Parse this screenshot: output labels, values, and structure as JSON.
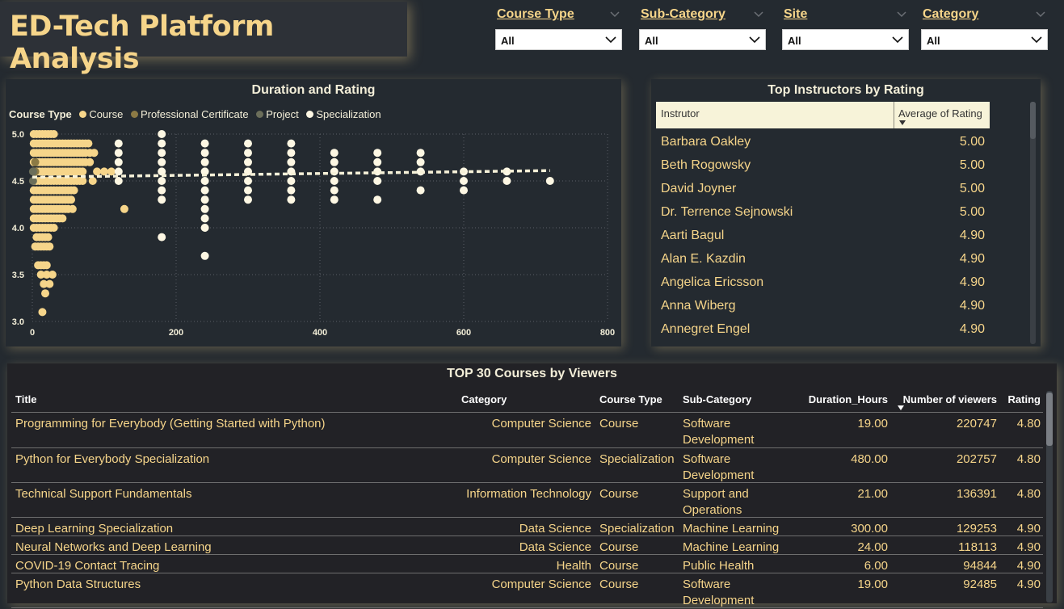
{
  "dashboard": {
    "title": "ED-Tech Platform Analysis"
  },
  "filters": [
    {
      "label": "Course Type",
      "value": "All"
    },
    {
      "label": "Sub-Category",
      "value": "All"
    },
    {
      "label": "Site",
      "value": "All"
    },
    {
      "label": "Category",
      "value": "All"
    }
  ],
  "scatter": {
    "title": "Duration and Rating",
    "legend_title": "Course Type",
    "legend": [
      {
        "name": "Course",
        "color": "#f6d58a"
      },
      {
        "name": "Professional Certificate",
        "color": "#8c7a45"
      },
      {
        "name": "Project",
        "color": "#6b6e5a"
      },
      {
        "name": "Specialization",
        "color": "#fdf7e3"
      }
    ]
  },
  "instructors": {
    "title": "Top Instructors by Rating",
    "col_name": "Instrutor",
    "col_rating": "Average of Rating",
    "rows": [
      {
        "name": "Barbara Oakley",
        "rating": "5.00"
      },
      {
        "name": "Beth Rogowsky",
        "rating": "5.00"
      },
      {
        "name": "David Joyner",
        "rating": "5.00"
      },
      {
        "name": "Dr. Terrence Sejnowski",
        "rating": "5.00"
      },
      {
        "name": "Aarti Bagul",
        "rating": "4.90"
      },
      {
        "name": "Alan E. Kazdin",
        "rating": "4.90"
      },
      {
        "name": "Angelica Ericsson",
        "rating": "4.90"
      },
      {
        "name": "Anna Wiberg",
        "rating": "4.90"
      },
      {
        "name": "Annegret Engel",
        "rating": "4.90"
      }
    ]
  },
  "courses": {
    "title": "TOP 30 Courses by Viewers",
    "columns": [
      "Title",
      "Category",
      "Course Type",
      "Sub-Category",
      "Duration_Hours",
      "Number of viewers",
      "Rating"
    ],
    "rows": [
      {
        "title": "Programming for Everybody (Getting Started with Python)",
        "category": "Computer Science",
        "type": "Course",
        "sub": "Software Development",
        "duration": "19.00",
        "viewers": "220747",
        "rating": "4.80"
      },
      {
        "title": "Python for Everybody Specialization",
        "category": "Computer Science",
        "type": "Specialization",
        "sub": "Software Development",
        "duration": "480.00",
        "viewers": "202757",
        "rating": "4.80"
      },
      {
        "title": "Technical Support Fundamentals",
        "category": "Information Technology",
        "type": "Course",
        "sub": "Support and Operations",
        "duration": "21.00",
        "viewers": "136391",
        "rating": "4.80"
      },
      {
        "title": "Deep Learning Specialization",
        "category": "Data Science",
        "type": "Specialization",
        "sub": "Machine Learning",
        "duration": "300.00",
        "viewers": "129253",
        "rating": "4.90"
      },
      {
        "title": "Neural Networks and Deep Learning",
        "category": "Data Science",
        "type": "Course",
        "sub": "Machine Learning",
        "duration": "24.00",
        "viewers": "118113",
        "rating": "4.90"
      },
      {
        "title": "COVID-19 Contact Tracing",
        "category": "Health",
        "type": "Course",
        "sub": "Public Health",
        "duration": "6.00",
        "viewers": "94844",
        "rating": "4.90"
      },
      {
        "title": "Python Data Structures",
        "category": "Computer Science",
        "type": "Course",
        "sub": "Software Development",
        "duration": "19.00",
        "viewers": "92485",
        "rating": "4.90"
      }
    ]
  },
  "chart_data": {
    "type": "scatter",
    "title": "Duration and Rating",
    "xlabel": "",
    "ylabel": "",
    "xlim": [
      0,
      800
    ],
    "ylim": [
      3.0,
      5.0
    ],
    "x_ticks": [
      "0",
      "200",
      "400",
      "600",
      "800"
    ],
    "y_ticks": [
      "3.0",
      "3.5",
      "4.0",
      "4.5",
      "5.0"
    ],
    "grid": true,
    "legend_placement": "top-left",
    "trend_line": {
      "x": [
        0,
        720
      ],
      "y": [
        4.54,
        4.61
      ]
    },
    "series": [
      {
        "name": "Course",
        "color": "#f6d58a",
        "points": [
          [
            2,
            5.0
          ],
          [
            6,
            5.0
          ],
          [
            10,
            5.0
          ],
          [
            14,
            5.0
          ],
          [
            18,
            5.0
          ],
          [
            22,
            5.0
          ],
          [
            26,
            5.0
          ],
          [
            30,
            5.0
          ],
          [
            2,
            4.9
          ],
          [
            6,
            4.9
          ],
          [
            10,
            4.9
          ],
          [
            14,
            4.9
          ],
          [
            18,
            4.9
          ],
          [
            22,
            4.9
          ],
          [
            26,
            4.9
          ],
          [
            30,
            4.9
          ],
          [
            34,
            4.9
          ],
          [
            38,
            4.9
          ],
          [
            42,
            4.9
          ],
          [
            46,
            4.9
          ],
          [
            50,
            4.9
          ],
          [
            54,
            4.9
          ],
          [
            58,
            4.9
          ],
          [
            62,
            4.9
          ],
          [
            66,
            4.9
          ],
          [
            70,
            4.9
          ],
          [
            74,
            4.9
          ],
          [
            78,
            4.9
          ],
          [
            2,
            4.8
          ],
          [
            6,
            4.8
          ],
          [
            10,
            4.8
          ],
          [
            14,
            4.8
          ],
          [
            18,
            4.8
          ],
          [
            22,
            4.8
          ],
          [
            26,
            4.8
          ],
          [
            30,
            4.8
          ],
          [
            34,
            4.8
          ],
          [
            38,
            4.8
          ],
          [
            42,
            4.8
          ],
          [
            46,
            4.8
          ],
          [
            50,
            4.8
          ],
          [
            54,
            4.8
          ],
          [
            58,
            4.8
          ],
          [
            62,
            4.8
          ],
          [
            66,
            4.8
          ],
          [
            70,
            4.8
          ],
          [
            74,
            4.8
          ],
          [
            80,
            4.8
          ],
          [
            86,
            4.8
          ],
          [
            2,
            4.7
          ],
          [
            6,
            4.7
          ],
          [
            10,
            4.7
          ],
          [
            14,
            4.7
          ],
          [
            18,
            4.7
          ],
          [
            22,
            4.7
          ],
          [
            26,
            4.7
          ],
          [
            30,
            4.7
          ],
          [
            34,
            4.7
          ],
          [
            38,
            4.7
          ],
          [
            42,
            4.7
          ],
          [
            46,
            4.7
          ],
          [
            50,
            4.7
          ],
          [
            54,
            4.7
          ],
          [
            58,
            4.7
          ],
          [
            62,
            4.7
          ],
          [
            66,
            4.7
          ],
          [
            70,
            4.7
          ],
          [
            74,
            4.7
          ],
          [
            80,
            4.7
          ],
          [
            2,
            4.6
          ],
          [
            6,
            4.6
          ],
          [
            10,
            4.6
          ],
          [
            14,
            4.6
          ],
          [
            18,
            4.6
          ],
          [
            22,
            4.6
          ],
          [
            26,
            4.6
          ],
          [
            30,
            4.6
          ],
          [
            34,
            4.6
          ],
          [
            38,
            4.6
          ],
          [
            42,
            4.6
          ],
          [
            46,
            4.6
          ],
          [
            50,
            4.6
          ],
          [
            54,
            4.6
          ],
          [
            58,
            4.6
          ],
          [
            62,
            4.6
          ],
          [
            66,
            4.6
          ],
          [
            70,
            4.6
          ],
          [
            90,
            4.6
          ],
          [
            100,
            4.6
          ],
          [
            110,
            4.6
          ],
          [
            2,
            4.5
          ],
          [
            6,
            4.5
          ],
          [
            10,
            4.5
          ],
          [
            14,
            4.5
          ],
          [
            18,
            4.5
          ],
          [
            22,
            4.5
          ],
          [
            26,
            4.5
          ],
          [
            30,
            4.5
          ],
          [
            34,
            4.5
          ],
          [
            38,
            4.5
          ],
          [
            42,
            4.5
          ],
          [
            46,
            4.5
          ],
          [
            50,
            4.5
          ],
          [
            54,
            4.5
          ],
          [
            58,
            4.5
          ],
          [
            62,
            4.5
          ],
          [
            66,
            4.5
          ],
          [
            70,
            4.5
          ],
          [
            84,
            4.5
          ],
          [
            2,
            4.4
          ],
          [
            6,
            4.4
          ],
          [
            10,
            4.4
          ],
          [
            14,
            4.4
          ],
          [
            18,
            4.4
          ],
          [
            22,
            4.4
          ],
          [
            26,
            4.4
          ],
          [
            30,
            4.4
          ],
          [
            34,
            4.4
          ],
          [
            38,
            4.4
          ],
          [
            42,
            4.4
          ],
          [
            46,
            4.4
          ],
          [
            50,
            4.4
          ],
          [
            54,
            4.4
          ],
          [
            58,
            4.4
          ],
          [
            2,
            4.3
          ],
          [
            6,
            4.3
          ],
          [
            10,
            4.3
          ],
          [
            14,
            4.3
          ],
          [
            18,
            4.3
          ],
          [
            22,
            4.3
          ],
          [
            26,
            4.3
          ],
          [
            30,
            4.3
          ],
          [
            34,
            4.3
          ],
          [
            38,
            4.3
          ],
          [
            42,
            4.3
          ],
          [
            46,
            4.3
          ],
          [
            50,
            4.3
          ],
          [
            54,
            4.3
          ],
          [
            2,
            4.2
          ],
          [
            6,
            4.2
          ],
          [
            10,
            4.2
          ],
          [
            14,
            4.2
          ],
          [
            18,
            4.2
          ],
          [
            22,
            4.2
          ],
          [
            26,
            4.2
          ],
          [
            30,
            4.2
          ],
          [
            34,
            4.2
          ],
          [
            38,
            4.2
          ],
          [
            42,
            4.2
          ],
          [
            46,
            4.2
          ],
          [
            50,
            4.2
          ],
          [
            56,
            4.2
          ],
          [
            2,
            4.1
          ],
          [
            6,
            4.1
          ],
          [
            10,
            4.1
          ],
          [
            14,
            4.1
          ],
          [
            18,
            4.1
          ],
          [
            22,
            4.1
          ],
          [
            26,
            4.1
          ],
          [
            30,
            4.1
          ],
          [
            34,
            4.1
          ],
          [
            38,
            4.1
          ],
          [
            42,
            4.1
          ],
          [
            2,
            4.0
          ],
          [
            6,
            4.0
          ],
          [
            10,
            4.0
          ],
          [
            14,
            4.0
          ],
          [
            18,
            4.0
          ],
          [
            22,
            4.0
          ],
          [
            26,
            4.0
          ],
          [
            30,
            4.0
          ],
          [
            6,
            3.9
          ],
          [
            10,
            3.9
          ],
          [
            14,
            3.9
          ],
          [
            18,
            3.9
          ],
          [
            22,
            3.9
          ],
          [
            4,
            3.8
          ],
          [
            8,
            3.8
          ],
          [
            12,
            3.8
          ],
          [
            16,
            3.8
          ],
          [
            20,
            3.8
          ],
          [
            24,
            3.8
          ],
          [
            8,
            3.6
          ],
          [
            12,
            3.6
          ],
          [
            16,
            3.6
          ],
          [
            20,
            3.6
          ],
          [
            12,
            3.5
          ],
          [
            20,
            3.5
          ],
          [
            28,
            3.5
          ],
          [
            16,
            3.4
          ],
          [
            24,
            3.4
          ],
          [
            18,
            3.3
          ],
          [
            14,
            3.1
          ],
          [
            128,
            4.2
          ]
        ]
      },
      {
        "name": "Professional Certificate",
        "color": "#8c7a45",
        "points": [
          [
            4,
            4.7
          ],
          [
            4,
            4.6
          ]
        ]
      },
      {
        "name": "Project",
        "color": "#6b6e5a",
        "points": [
          [
            1,
            4.6
          ],
          [
            1,
            4.5
          ]
        ]
      },
      {
        "name": "Specialization",
        "color": "#fdf7e3",
        "points": [
          [
            120,
            4.9
          ],
          [
            120,
            4.8
          ],
          [
            120,
            4.7
          ],
          [
            120,
            4.6
          ],
          [
            120,
            4.5
          ],
          [
            180,
            5.0
          ],
          [
            180,
            4.9
          ],
          [
            180,
            4.8
          ],
          [
            180,
            4.7
          ],
          [
            180,
            4.6
          ],
          [
            180,
            4.5
          ],
          [
            180,
            4.4
          ],
          [
            180,
            4.3
          ],
          [
            180,
            3.9
          ],
          [
            240,
            4.9
          ],
          [
            240,
            4.8
          ],
          [
            240,
            4.7
          ],
          [
            240,
            4.6
          ],
          [
            240,
            4.5
          ],
          [
            240,
            4.4
          ],
          [
            240,
            4.3
          ],
          [
            240,
            4.2
          ],
          [
            240,
            4.1
          ],
          [
            240,
            4.0
          ],
          [
            240,
            3.7
          ],
          [
            300,
            4.9
          ],
          [
            300,
            4.8
          ],
          [
            300,
            4.7
          ],
          [
            300,
            4.6
          ],
          [
            300,
            4.5
          ],
          [
            300,
            4.4
          ],
          [
            300,
            4.3
          ],
          [
            360,
            4.9
          ],
          [
            360,
            4.8
          ],
          [
            360,
            4.7
          ],
          [
            360,
            4.6
          ],
          [
            360,
            4.5
          ],
          [
            360,
            4.4
          ],
          [
            360,
            4.3
          ],
          [
            420,
            4.8
          ],
          [
            420,
            4.7
          ],
          [
            420,
            4.6
          ],
          [
            420,
            4.5
          ],
          [
            420,
            4.4
          ],
          [
            420,
            4.3
          ],
          [
            480,
            4.8
          ],
          [
            480,
            4.7
          ],
          [
            480,
            4.6
          ],
          [
            480,
            4.5
          ],
          [
            480,
            4.3
          ],
          [
            540,
            4.8
          ],
          [
            540,
            4.7
          ],
          [
            540,
            4.6
          ],
          [
            540,
            4.4
          ],
          [
            600,
            4.6
          ],
          [
            600,
            4.5
          ],
          [
            600,
            4.4
          ],
          [
            660,
            4.6
          ],
          [
            660,
            4.5
          ],
          [
            720,
            4.5
          ]
        ]
      }
    ]
  }
}
